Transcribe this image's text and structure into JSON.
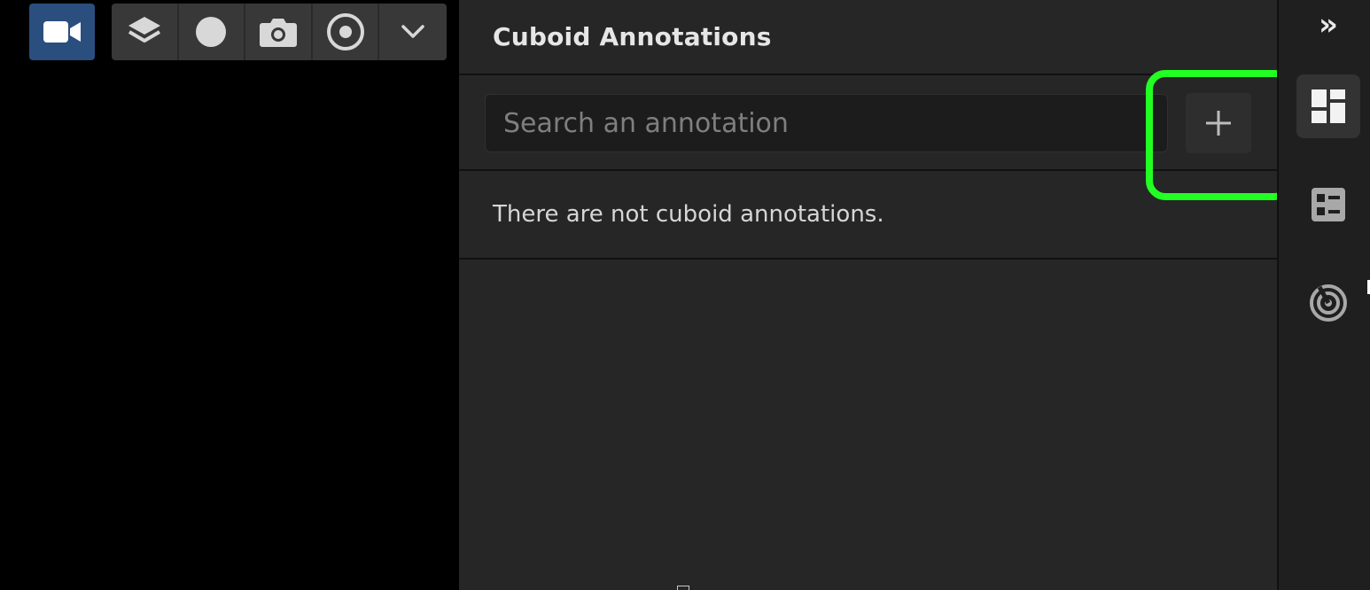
{
  "toolbar": {
    "camera_button": {
      "icon": "video-camera-icon",
      "color": "#2a4e7e"
    },
    "tools": [
      {
        "name": "layers-tool-button",
        "icon": "layers-icon"
      },
      {
        "name": "point-tool-button",
        "icon": "filled-circle-icon"
      },
      {
        "name": "snapshot-tool-button",
        "icon": "camera-icon"
      },
      {
        "name": "target-tool-button",
        "icon": "target-circle-icon"
      },
      {
        "name": "more-tools-button",
        "icon": "chevron-down-icon"
      }
    ]
  },
  "panel": {
    "title": "Cuboid Annotations",
    "search": {
      "placeholder": "Search an annotation",
      "value": ""
    },
    "add_button": {
      "label": "+",
      "icon": "plus-icon"
    },
    "empty_message": "There are not cuboid annotations."
  },
  "sidebar": {
    "collapse_label": "»",
    "items": [
      {
        "name": "sidebar-item-dashboard",
        "icon": "dashboard-icon",
        "active": true
      },
      {
        "name": "sidebar-item-list",
        "icon": "list-icon",
        "active": false
      },
      {
        "name": "sidebar-item-radar",
        "icon": "radar-icon",
        "active": false
      }
    ]
  },
  "colors": {
    "highlight": "#22ff22",
    "panel_bg": "#262626",
    "accent": "#2a4e7e"
  }
}
